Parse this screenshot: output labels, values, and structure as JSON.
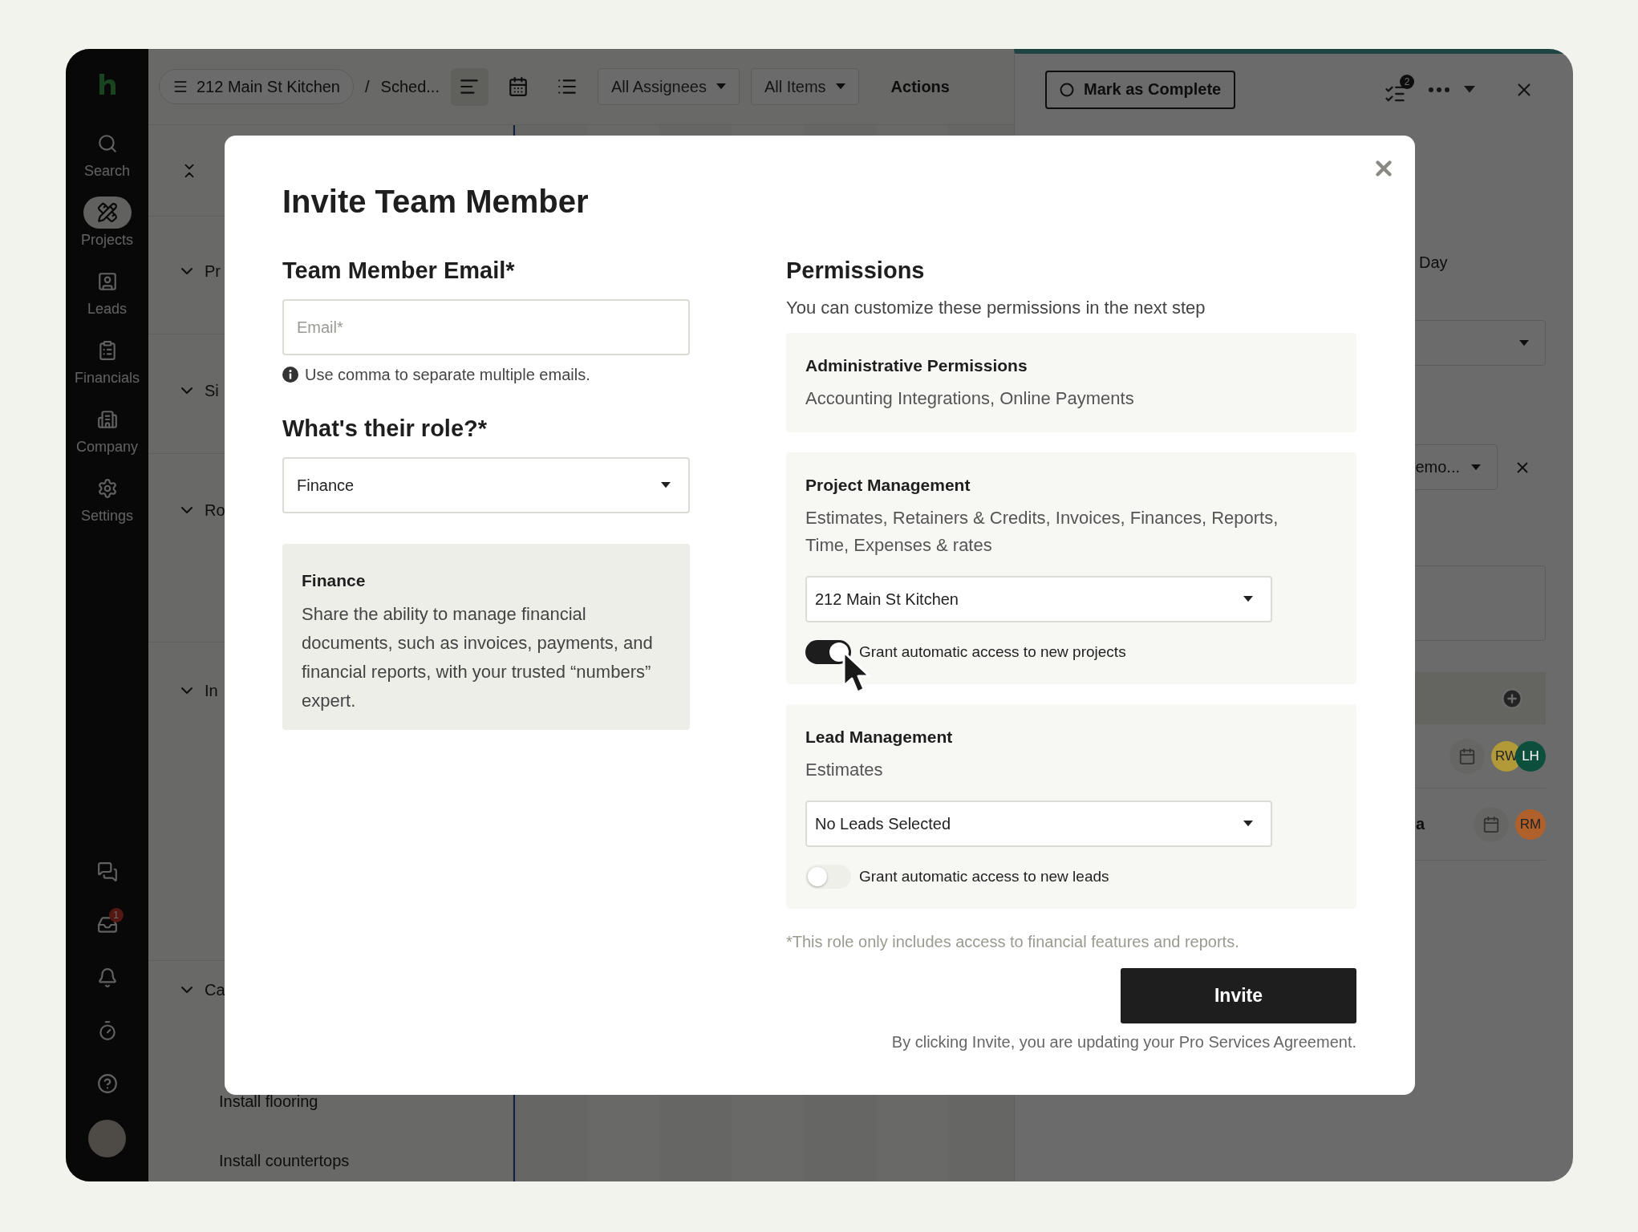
{
  "sidebar": {
    "items": [
      {
        "label": "Search",
        "selected": false
      },
      {
        "label": "Projects",
        "selected": true
      },
      {
        "label": "Leads",
        "selected": false
      },
      {
        "label": "Financials",
        "selected": false
      },
      {
        "label": "Company",
        "selected": false
      },
      {
        "label": "Settings",
        "selected": false
      }
    ],
    "inbox_badge": "1"
  },
  "top_bar": {
    "project": "212 Main St Kitchen",
    "separator": "/",
    "page": "Sched...",
    "views": [
      {
        "selected": true
      },
      {
        "selected": false
      },
      {
        "selected": false
      }
    ],
    "filters": [
      "All Assignees",
      "All Items"
    ],
    "actions": "Actions"
  },
  "task_list": {
    "sections": [
      {
        "label": "Pr"
      },
      {
        "label": "Si"
      },
      {
        "label": "Ro"
      },
      {
        "label": "In"
      },
      {
        "label": "Ca"
      }
    ],
    "tasks": [
      "Install flooring",
      "Install countertops"
    ]
  },
  "detail_panel": {
    "complete_button": "Mark as Complete",
    "checklist_badge": "2",
    "day_label": "Day",
    "reminder_select": "emo...",
    "rows": [
      {
        "text": "",
        "avatars": [
          {
            "initials": "RW",
            "color": "#b39a38"
          },
          {
            "initials": "LH",
            "color": "#0c4f3c"
          }
        ]
      },
      {
        "text": "a",
        "avatars": [
          {
            "initials": "RM",
            "color": "#b0602a"
          }
        ]
      }
    ]
  },
  "modal": {
    "title": "Invite Team Member",
    "email": {
      "heading": "Team Member Email*",
      "placeholder": "Email*",
      "hint": "Use comma to separate multiple emails."
    },
    "role": {
      "heading": "What's their role?*",
      "value": "Finance"
    },
    "role_card": {
      "title": "Finance",
      "description": "Share the ability to manage financial documents, such as invoices, payments, and financial reports, with your trusted “numbers” expert."
    },
    "permissions": {
      "heading": "Permissions",
      "subtitle": "You can customize these permissions in the next step",
      "groups": [
        {
          "kind": "info",
          "title": "Administrative Permissions",
          "items": "Accounting Integrations, Online Payments"
        },
        {
          "kind": "select",
          "title": "Project Management",
          "items": "Estimates, Retainers & Credits, Invoices, Finances, Reports, Time, Expenses & rates",
          "select": "212 Main St Kitchen",
          "toggle": {
            "label": "Grant automatic access to new projects",
            "on": true,
            "pointer_over": true
          }
        },
        {
          "kind": "select",
          "title": "Lead Management",
          "items": "Estimates",
          "select": "No Leads Selected",
          "toggle": {
            "label": "Grant automatic access to new leads",
            "on": false,
            "pointer_over": false
          }
        }
      ]
    },
    "footnote": "*This role only includes access to financial features and reports.",
    "invite_button": "Invite",
    "agreement": "By clicking Invite, you are updating your Pro Services Agreement."
  }
}
